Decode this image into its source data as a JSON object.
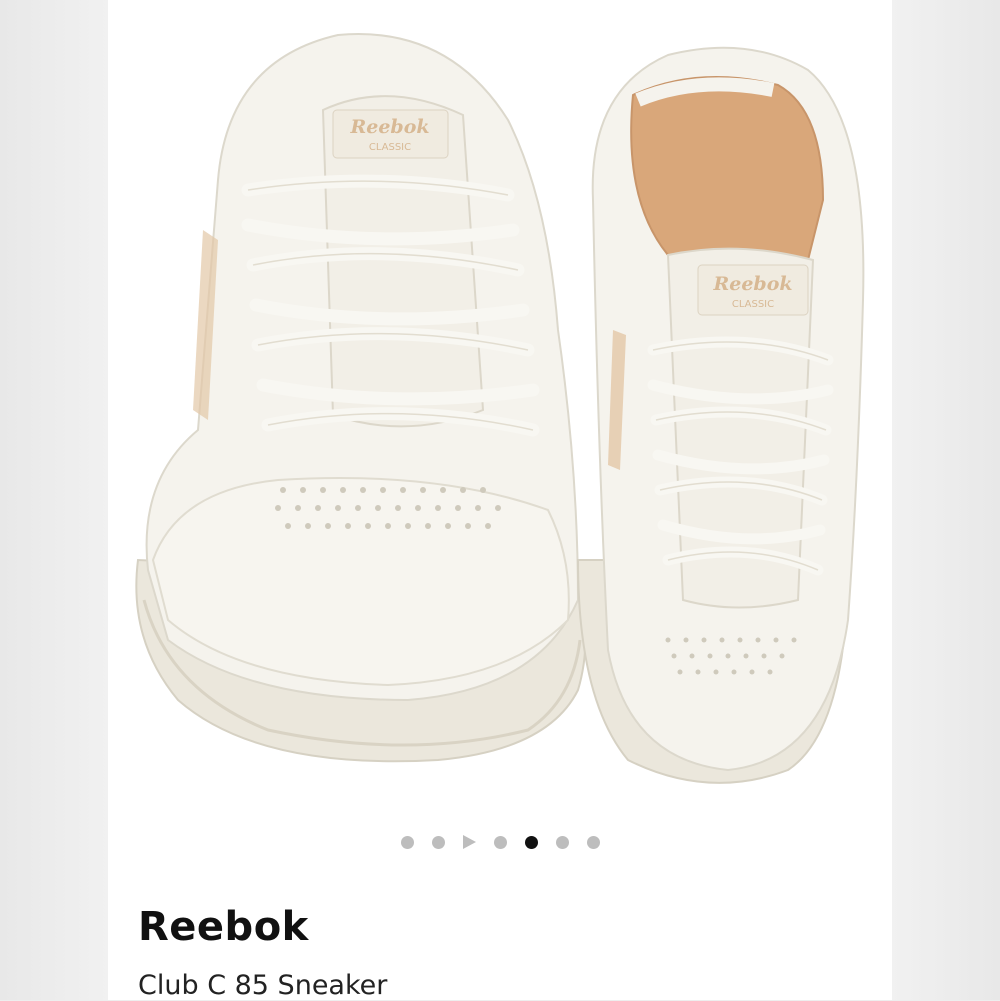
{
  "product": {
    "brand": "Reebok",
    "name": "Club C 85 Sneaker",
    "logo_text": "Reebok",
    "logo_subtext": "CLASSIC"
  },
  "carousel": {
    "total": 7,
    "active_index": 4,
    "video_index": 2
  },
  "colors": {
    "shoe": "#f3f1ea",
    "accent": "#e3c7a6",
    "lining": "#d9a77a",
    "active_dot": "#111111",
    "inactive_dot": "#bdbdbd"
  }
}
